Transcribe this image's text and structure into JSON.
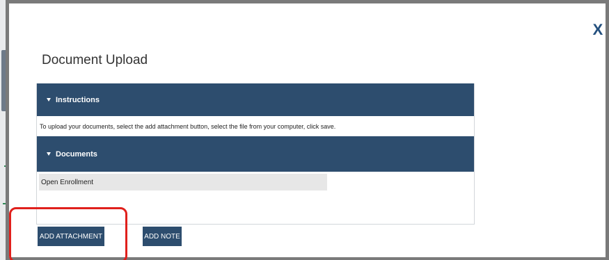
{
  "modal": {
    "title": "Document Upload",
    "close_icon": "close-icon",
    "close_glyph": "X"
  },
  "instructions": {
    "header": "Instructions",
    "text": "To upload your documents, select the add attachment button, select the file from your computer, click save."
  },
  "documents": {
    "header": "Documents",
    "items": [
      "Open Enrollment"
    ]
  },
  "buttons": {
    "add_attachment": "ADD ATTACHMENT",
    "add_note": "ADD NOTE"
  },
  "colors": {
    "header_bg": "#2d4d6e",
    "close_color": "#24507e",
    "highlight": "#e0201c",
    "row_bg": "#e7e7e7"
  }
}
